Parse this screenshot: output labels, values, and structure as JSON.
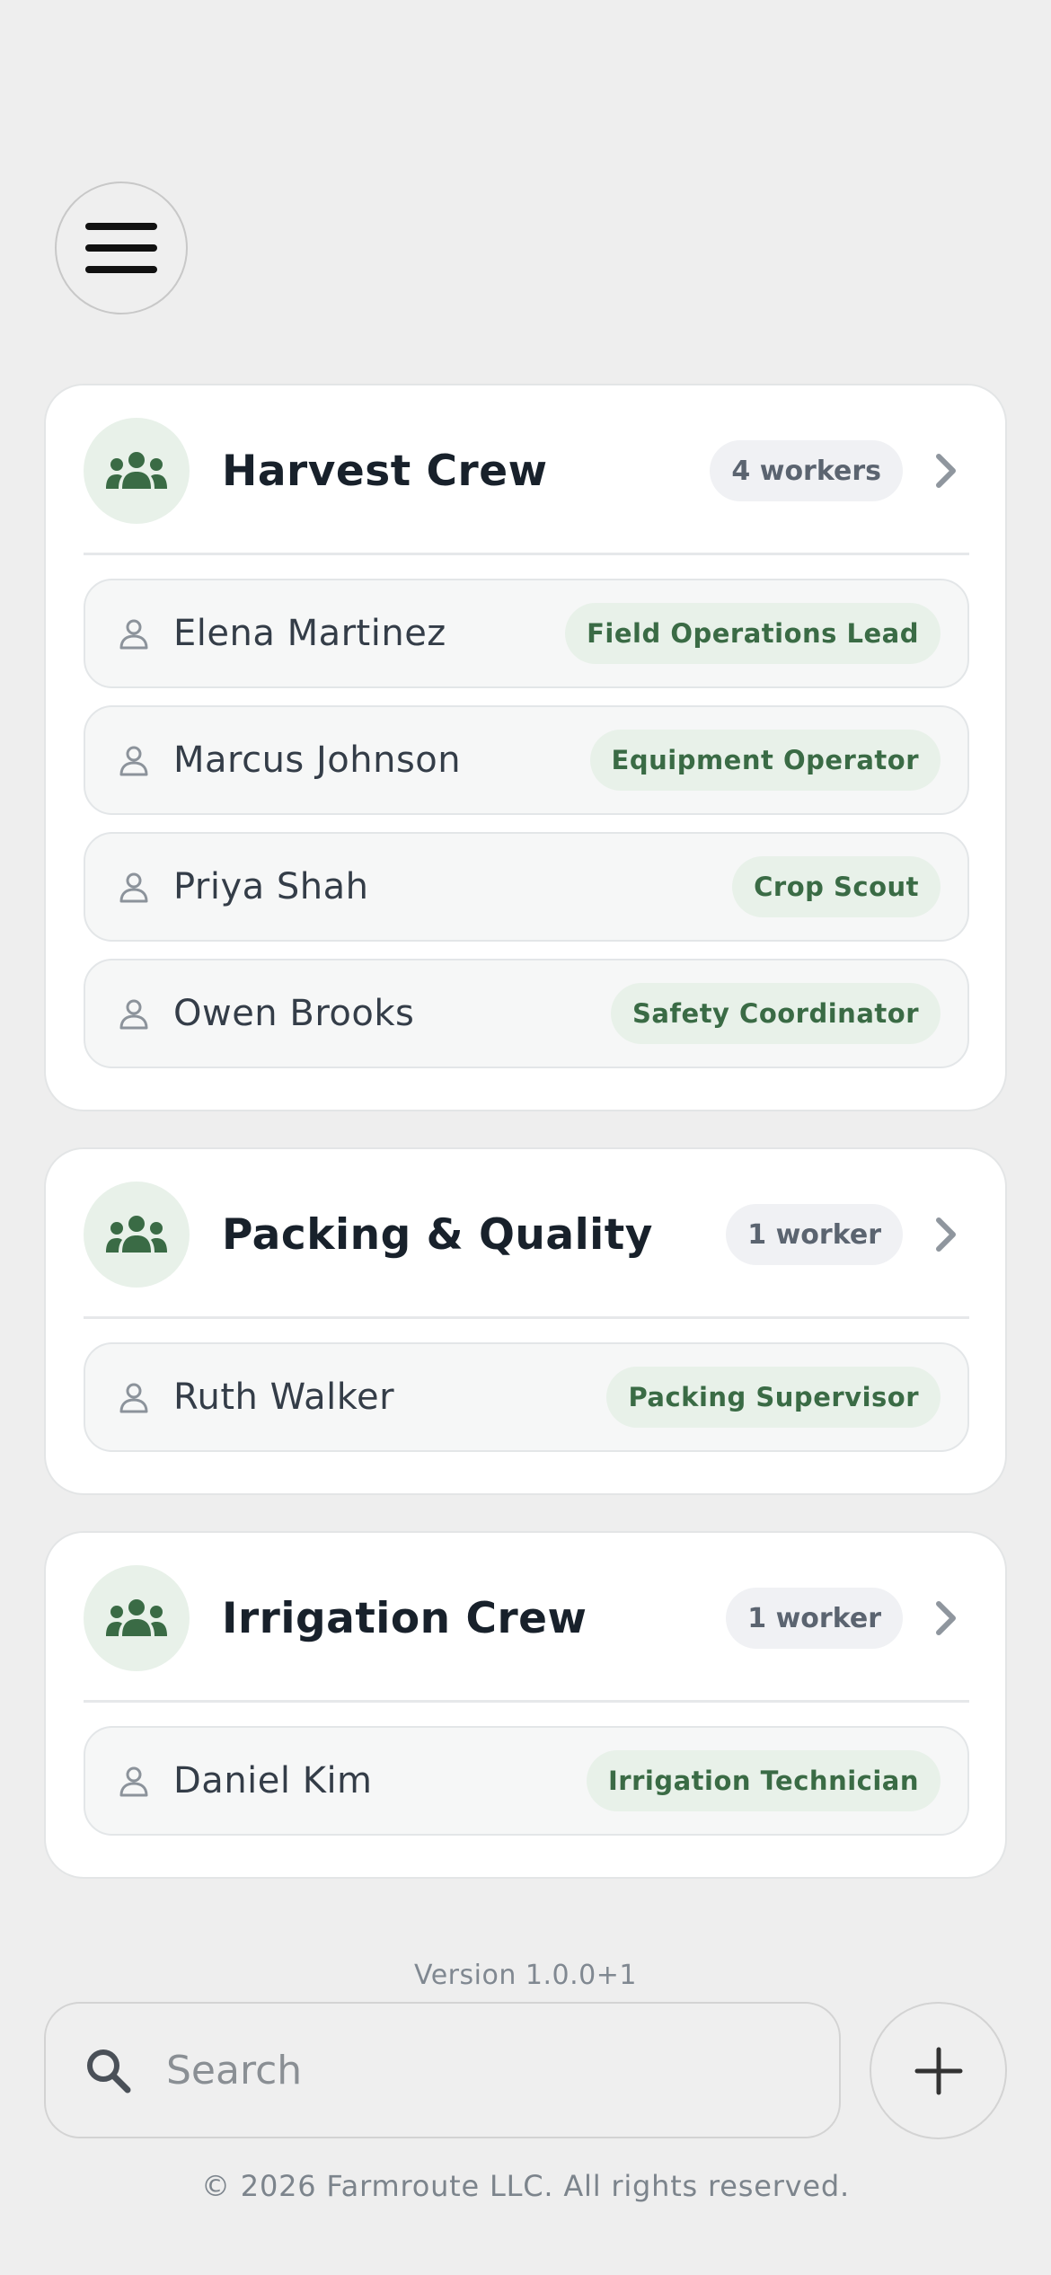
{
  "header": {
    "menu_icon": "hamburger-menu-icon"
  },
  "groups": [
    {
      "name": "Harvest Crew",
      "count_label": "4 workers",
      "workers": [
        {
          "name": "Elena Martinez",
          "role": "Field Operations Lead"
        },
        {
          "name": "Marcus Johnson",
          "role": "Equipment Operator"
        },
        {
          "name": "Priya Shah",
          "role": "Crop Scout"
        },
        {
          "name": "Owen Brooks",
          "role": "Safety Coordinator"
        }
      ]
    },
    {
      "name": "Packing & Quality",
      "count_label": "1 worker",
      "workers": [
        {
          "name": "Ruth Walker",
          "role": "Packing Supervisor"
        }
      ]
    },
    {
      "name": "Irrigation Crew",
      "count_label": "1 worker",
      "workers": [
        {
          "name": "Daniel Kim",
          "role": "Irrigation Technician"
        }
      ]
    }
  ],
  "footer": {
    "version": "Version 1.0.0+1",
    "search_placeholder": "Search",
    "copyright": "© 2026 Farmroute LLC. All rights reserved."
  },
  "colors": {
    "accent_green": "#3a6b45",
    "accent_green_bg": "#e8f1e9",
    "background": "#eeeeee"
  }
}
